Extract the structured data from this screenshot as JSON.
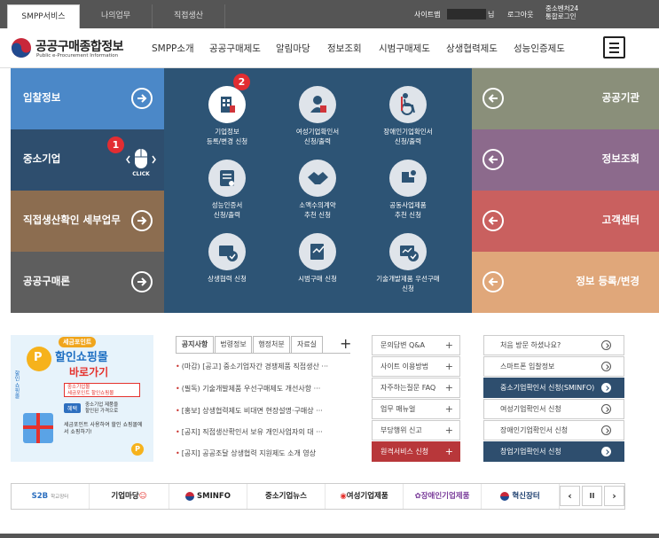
{
  "topbar": {
    "tabs": [
      {
        "label": "SMPP서비스",
        "active": true
      },
      {
        "label": "나의업무",
        "active": false
      },
      {
        "label": "직접생산",
        "active": false
      }
    ],
    "site_map": "사이트맵",
    "user_suffix": "님",
    "logout": "로그아웃",
    "sso_line1": "중소벤처24",
    "sso_line2": "통합로그인"
  },
  "header": {
    "logo_title": "공공구매종합정보",
    "logo_sub": "Public e-Procurement Information",
    "nav": [
      "SMPP소개",
      "공공구매제도",
      "알림마당",
      "정보조회",
      "시범구매제도",
      "상생협력제도",
      "성능인증제도"
    ]
  },
  "left_menu": [
    {
      "label": "입찰정보",
      "color": "#4b88c8"
    },
    {
      "label": "중소기업",
      "color": "#2e4e6e"
    },
    {
      "label": "직접생산확인 세부업무",
      "color": "#8c6d50"
    },
    {
      "label": "공공구매론",
      "color": "#5e5e5e"
    }
  ],
  "click_hint": {
    "badge": "1",
    "text": "CLICK"
  },
  "center_items": [
    {
      "line1": "기업정보",
      "line2": "등록/변경 신청",
      "icon": "building-icon",
      "badge": "2"
    },
    {
      "line1": "여성기업확인서",
      "line2": "신청/출력",
      "icon": "woman-icon"
    },
    {
      "line1": "장애인기업확인서",
      "line2": "신청/출력",
      "icon": "wheelchair-icon"
    },
    {
      "line1": "성능인증서",
      "line2": "신청/출력",
      "icon": "certificate-icon"
    },
    {
      "line1": "소액수의계약",
      "line2": "추천 신청",
      "icon": "handshake-icon"
    },
    {
      "line1": "공동사업제품",
      "line2": "추천 신청",
      "icon": "cooperation-icon"
    },
    {
      "line1": "상생협력 신청",
      "line2": "",
      "icon": "cooperation-check-icon"
    },
    {
      "line1": "시범구매 신청",
      "line2": "",
      "icon": "pilot-purchase-icon"
    },
    {
      "line1": "기술개발제품 우선구매",
      "line2": "신청",
      "icon": "tech-product-icon"
    }
  ],
  "right_menu": [
    {
      "label": "공공기관",
      "color": "#8a8f7a"
    },
    {
      "label": "정보조회",
      "color": "#8c6a8c"
    },
    {
      "label": "고객센터",
      "color": "#c9605f"
    },
    {
      "label": "정보 등록/변경",
      "color": "#e0a77a"
    }
  ],
  "promo": {
    "badge": "세금포인트",
    "title1": "할인쇼핑몰",
    "title2": "바로가기",
    "box1": "중소기업몰",
    "box2": "세금포인트 할인쇼핑몰",
    "tag": "혜택",
    "desc1": "중소기업 제품을",
    "desc2": "할인된 가격으로",
    "note": "세금포인트 사용하여 할인 쇼핑몰에서 쇼핑하기!",
    "side_label": "할인 쇼핑몰"
  },
  "notice": {
    "tabs": [
      "공지사항",
      "법령정보",
      "행정처분",
      "자료실"
    ],
    "plus": "+",
    "items": [
      "(마감) [공고] 중소기업자간 경쟁제품 직접생산 ···",
      "(필독) 기술개발제품 우선구매제도 개선사항 ···",
      "[홍보] 상생협력제도 비대면 현장설명·구매상 ···",
      "[공지] 직접생산확인서 보유 개인사업자의 대 ···",
      "[공지] 공공조달 상생협력 지원제도 소개 영상"
    ]
  },
  "quick_links": [
    {
      "label": "문의답변 Q&A",
      "highlight": false
    },
    {
      "label": "사이트 이용방법",
      "highlight": false
    },
    {
      "label": "자주하는질문 FAQ",
      "highlight": false
    },
    {
      "label": "업무 매뉴얼",
      "highlight": false
    },
    {
      "label": "부당행위 신고",
      "highlight": false
    },
    {
      "label": "원격서비스 신청",
      "highlight": true
    }
  ],
  "cert_links": [
    {
      "label": "처음 방문 하셨나요?",
      "dark": false
    },
    {
      "label": "스마트폰 입찰정보",
      "dark": false
    },
    {
      "label": "중소기업확인서 신청(SMINFO)",
      "dark": true
    },
    {
      "label": "여성기업확인서 신청",
      "dark": false
    },
    {
      "label": "장애인기업확인서 신청",
      "dark": false
    },
    {
      "label": "창업기업확인서 신청",
      "dark": true
    }
  ],
  "banners": [
    {
      "label": "S2B",
      "sub": "학교장터",
      "color": "#2c6fbf"
    },
    {
      "label": "기업마당",
      "color": "#222222"
    },
    {
      "label": "SMINFO",
      "color": "#222222"
    },
    {
      "label": "중소기업뉴스",
      "color": "#222222"
    },
    {
      "label": "여성기업제품",
      "color": "#222222"
    },
    {
      "label": "장애인기업제품",
      "color": "#7a3c9a"
    },
    {
      "label": "혁신장터",
      "color": "#1c3e6e"
    }
  ],
  "banner_controls": {
    "prev": "‹",
    "pause": "II",
    "next": "›"
  }
}
